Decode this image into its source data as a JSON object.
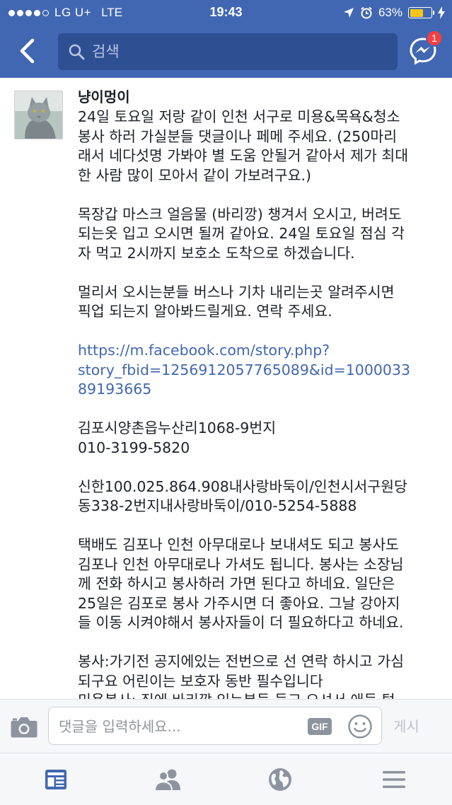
{
  "status_bar": {
    "carrier": "LG U+",
    "network": "LTE",
    "time": "19:43",
    "battery_percent": "63%",
    "battery_level": 0.63,
    "signal_bars_filled": 4,
    "signal_bars_total": 5
  },
  "nav": {
    "search_placeholder": "검색",
    "messenger_badge": "1"
  },
  "post": {
    "author": "냥이멍이",
    "paragraphs": [
      "24일 토요일 저랑 같이 인천 서구로 미용&목욕&청소\n봉사 하러 가실분들 댓글이나 페메 주세요. (250마리\n래서 네다섯명 가봐야 별 도움 안될거 같아서 제가 최대\n한 사람 많이 모아서 같이 가보려구요.)",
      "목장갑 마스크 얼음물 (바리깡) 챙겨서 오시고, 버려도\n되는옷 입고 오시면 될꺼 같아요. 24일 토요일 점심 각\n자 먹고 2시까지 보호소 도착으로 하겠습니다.",
      "멀리서 오시는분들 버스나 기차 내리는곳 알려주시면\n픽업 되는지 알아봐드릴게요. 연락 주세요."
    ],
    "link": "https://m.facebook.com/story.php?\nstory_fbid=1256912057765089&id=1000033\n89193665",
    "address": "김포시양촌읍누산리1068-9번지\n010-3199-5820",
    "bank": "신한100.025.864.908내사랑바둑이/인천시서구원당\n동338-2번지내사랑바둑이/010-5254-5888",
    "delivery": "택배도 김포나 인천 아무대로나 보내셔도 되고 봉사도\n김포나 인천 아무대로나 가셔도 됩니다. 봉사는 소장님\n께 전화 하시고 봉사하러 가면 된다고 하네요. 일단은\n25일은 김포로 봉사 가주시면 더 좋아요. 그날 강아지\n들 이동 시켜야해서 봉사자들이 더 필요하다고 하네요.",
    "volunteer": "봉사:가기전 공지에있는 전번으로 선 연락 하시고 가심\n되구요 어린이는 보호자 동반 필수입니다\n미용봉사: 집에 바리깡 있는분들 들고 오셔서 애들 털"
  },
  "comment_bar": {
    "placeholder": "댓글을 입력하세요...",
    "gif_label": "GIF",
    "post_label": "게시"
  },
  "tabs": [
    {
      "icon": "news-feed-icon",
      "active": true
    },
    {
      "icon": "friends-icon",
      "active": false
    },
    {
      "icon": "globe-notifications-icon",
      "active": false
    },
    {
      "icon": "menu-icon",
      "active": false
    }
  ],
  "colors": {
    "brand_blue": "#4267b2",
    "search_bg": "#2f4f93",
    "link": "#4267b2",
    "badge_red": "#fa3e3e",
    "battery_yellow": "#f5c518",
    "icon_gray": "#8d949e"
  }
}
